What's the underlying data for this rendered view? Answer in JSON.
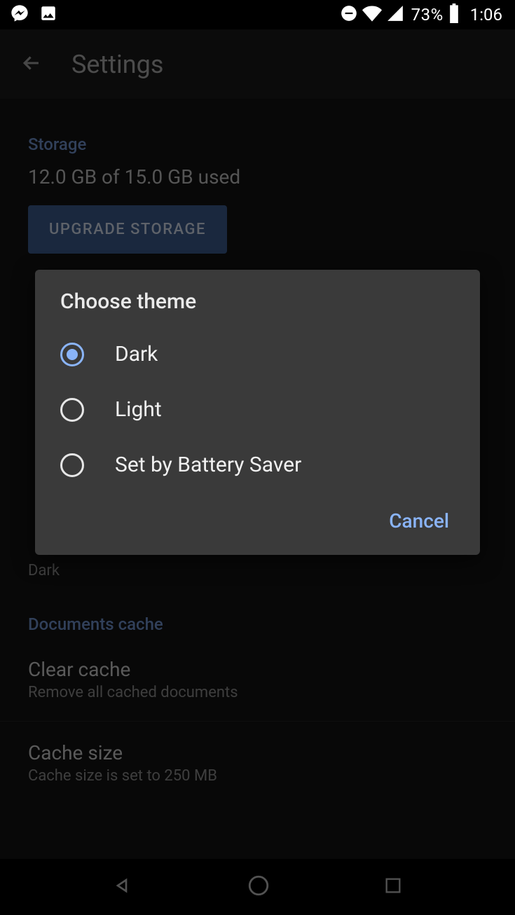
{
  "status": {
    "battery_pct": "73%",
    "time": "1:06"
  },
  "appbar": {
    "title": "Settings"
  },
  "storage": {
    "header": "Storage",
    "usage": "12.0 GB of 15.0 GB used",
    "upgrade_label": "UPGRADE STORAGE"
  },
  "theme_row": {
    "current": "Dark"
  },
  "docs_cache": {
    "header": "Documents cache",
    "clear_title": "Clear cache",
    "clear_sub": "Remove all cached documents",
    "size_title": "Cache size",
    "size_sub": "Cache size is set to 250 MB"
  },
  "dialog": {
    "title": "Choose theme",
    "options": {
      "dark": "Dark",
      "light": "Light",
      "battery": "Set by Battery Saver"
    },
    "cancel": "Cancel"
  }
}
